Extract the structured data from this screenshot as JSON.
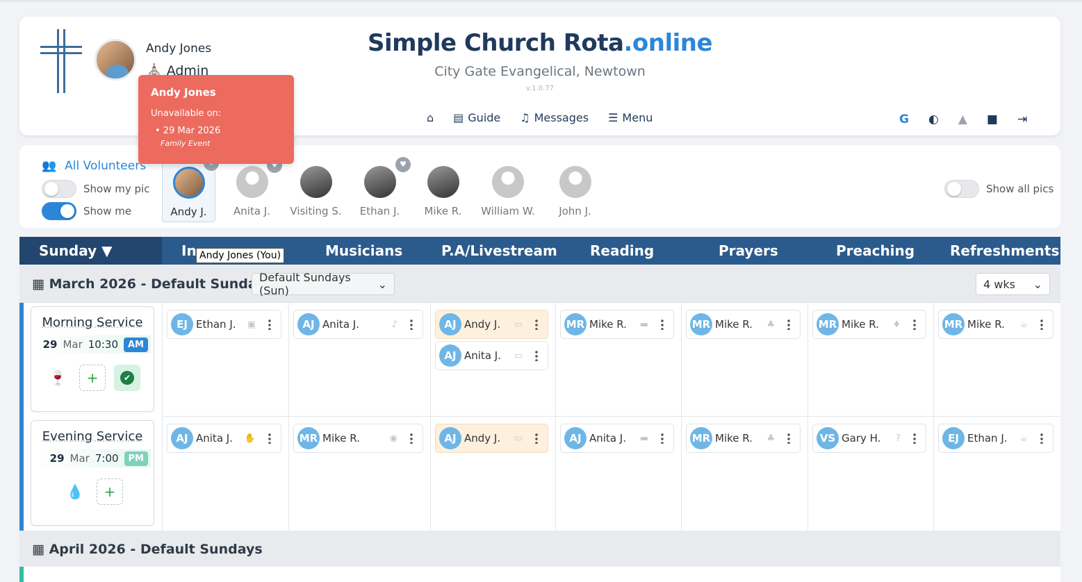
{
  "header": {
    "user_name": "Andy Jones",
    "user_role": "Admin",
    "site_title_main": "Simple Church Rota",
    "site_title_domain": ".online",
    "church": "City Gate Evangelical, Newtown",
    "version": "v.1.0.77",
    "nav": {
      "guide": "Guide",
      "messages": "Messages",
      "menu": "Menu"
    },
    "google_letter": "G"
  },
  "unavailable_tooltip": {
    "name": "Andy Jones",
    "label": "Unavailable on:",
    "date": "• 29 Mar 2026",
    "reason": "Family Event"
  },
  "volunteers": {
    "all_label": "All Volunteers",
    "show_my_pic": "Show my pic",
    "show_me": "Show me",
    "show_all_pics": "Show all pics",
    "people": [
      "Andy J.",
      "Anita J.",
      "Visiting S.",
      "Ethan J.",
      "Mike R.",
      "William W.",
      "John J."
    ]
  },
  "tabs": {
    "day": "Sunday",
    "roles": [
      "In...",
      "Musicians",
      "P.A/Livestream",
      "Reading",
      "Prayers",
      "Preaching",
      "Refreshments"
    ],
    "hover_tip": "Andy Jones (You)"
  },
  "month1": {
    "title": "March 2026 - Default Sundays",
    "rota_select": "Default Sundays (Sun)",
    "weeks_select": "4 wks"
  },
  "services": [
    {
      "name": "Morning Service",
      "day": "29",
      "month": "Mar",
      "time": "10:30",
      "ampm": "AM",
      "ampm_color": "#2c86d8"
    },
    {
      "name": "Evening Service",
      "day": "29",
      "month": "Mar",
      "time": "7:00",
      "ampm": "PM",
      "ampm_color": "#7fd1b9"
    }
  ],
  "morning": {
    "c1": {
      "ini": "EJ",
      "name": "Ethan J."
    },
    "c2": {
      "ini": "AJ",
      "name": "Anita J."
    },
    "c3a": {
      "ini": "AJ",
      "name": "Andy J."
    },
    "c3b": {
      "ini": "AJ",
      "name": "Anita J."
    },
    "c4": {
      "ini": "MR",
      "name": "Mike R."
    },
    "c5": {
      "ini": "MR",
      "name": "Mike R."
    },
    "c6": {
      "ini": "MR",
      "name": "Mike R."
    },
    "c7": {
      "ini": "MR",
      "name": "Mike R."
    }
  },
  "evening": {
    "c1": {
      "ini": "AJ",
      "name": "Anita J."
    },
    "c2": {
      "ini": "MR",
      "name": "Mike R."
    },
    "c3": {
      "ini": "AJ",
      "name": "Andy J."
    },
    "c4": {
      "ini": "AJ",
      "name": "Anita J."
    },
    "c5": {
      "ini": "MR",
      "name": "Mike R."
    },
    "c6": {
      "ini": "VS",
      "name": "Gary H."
    },
    "c7": {
      "ini": "EJ",
      "name": "Ethan J."
    }
  },
  "month2": {
    "title": "April 2026 - Default Sundays"
  }
}
